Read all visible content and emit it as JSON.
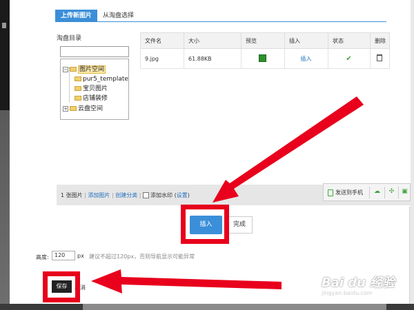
{
  "tabs": [
    {
      "label": "上传新图片"
    },
    {
      "label": "从淘盘选择"
    }
  ],
  "tree": {
    "title": "淘盘目录",
    "nodes": [
      {
        "label": "图片空间"
      },
      {
        "label": "pur5_template"
      },
      {
        "label": "宝贝图片"
      },
      {
        "label": "店铺装修"
      },
      {
        "label": "云盘空间"
      }
    ]
  },
  "table": {
    "columns": [
      "文件名",
      "大小",
      "预览",
      "插入",
      "状态",
      "删除"
    ],
    "rows": [
      {
        "filename": "9.jpg",
        "size": "61.88KB",
        "insert": "插入"
      }
    ]
  },
  "status_bar": {
    "count": "1 张图片",
    "add_image": "添加图片",
    "create_category": "创建分类",
    "watermark_label": "添加水印 (",
    "settings": "设置",
    "close_paren": ")"
  },
  "tools": {
    "send_to_phone": "发送到手机"
  },
  "buttons": {
    "insert": "插入",
    "done": "完成"
  },
  "height_form": {
    "label": "高度:",
    "value": "120",
    "unit": "px",
    "hint": "建议不超过120px，否则导航显示可能异常",
    "save": "保存",
    "cancel": "取消"
  },
  "colors": {
    "accent": "#3b8fd8",
    "highlight": "#e8001c"
  },
  "watermark": {
    "main": "Bai du 经验",
    "sub": "jingyan.baidu.com"
  }
}
